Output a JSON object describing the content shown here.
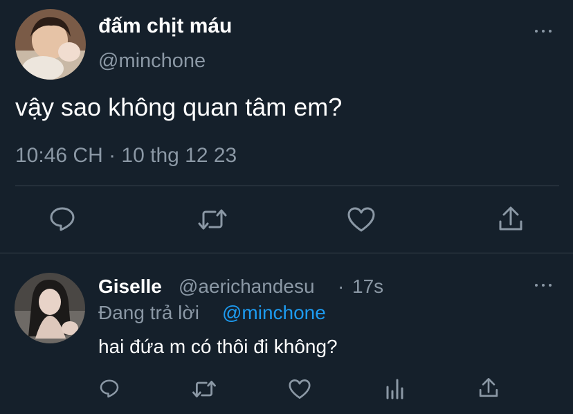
{
  "main_tweet": {
    "display_name": "đấm chịt máu",
    "handle": "@minchone",
    "text": "vậy sao không quan tâm em?",
    "timestamp": "10:46 CH · 10 thg 12 23",
    "actions": [
      "reply-icon",
      "retweet-icon",
      "like-icon",
      "share-icon"
    ]
  },
  "reply_tweet": {
    "display_name": "Giselle",
    "handle": "@aerichandesu",
    "separator": "·",
    "time_ago": "17s",
    "replying_to_label": "Đang trả lời",
    "replying_to_handle": "@minchone",
    "text": "hai đứa m có thôi đi không?",
    "actions": [
      "reply-icon",
      "retweet-icon",
      "like-icon",
      "analytics-icon",
      "share-icon"
    ]
  },
  "colors": {
    "background": "#15202b",
    "text": "#ffffff",
    "muted": "#8b98a5",
    "link": "#1d9bf0",
    "divider": "#38444d"
  }
}
